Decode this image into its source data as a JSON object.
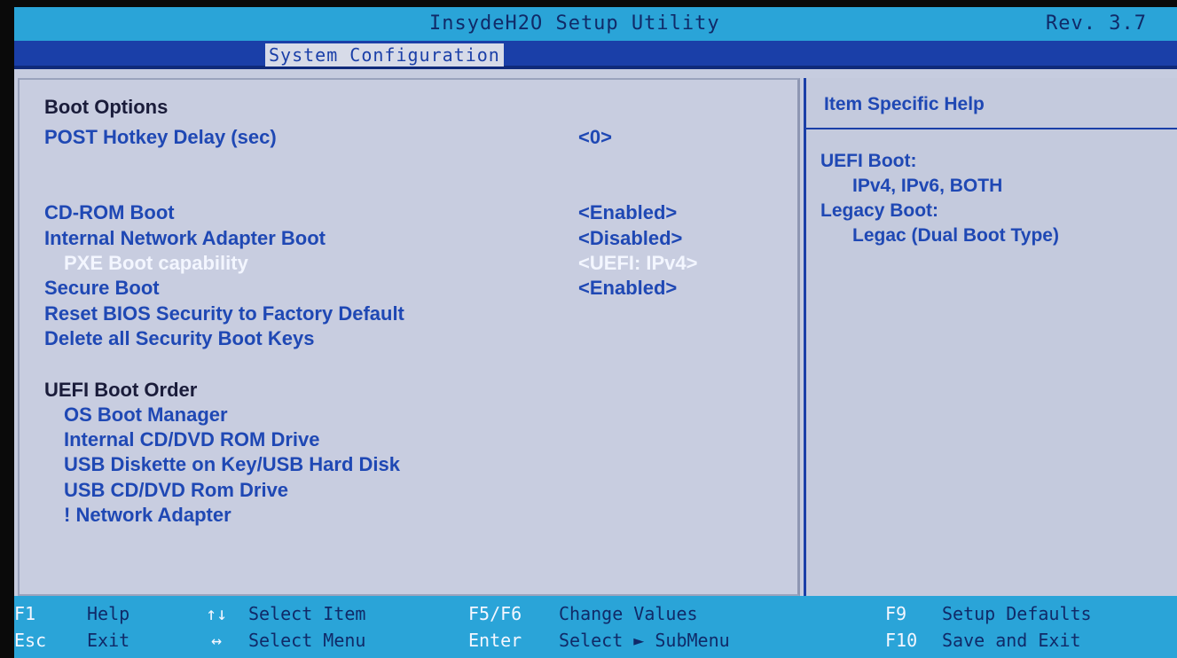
{
  "titlebar": {
    "title": "InsydeH2O Setup Utility",
    "rev": "Rev. 3.7"
  },
  "tab": {
    "active": "System Configuration"
  },
  "boot_options": {
    "section_label": "Boot Options",
    "items": [
      {
        "label": "POST Hotkey Delay (sec)",
        "value": "<0>"
      },
      {
        "label": "CD-ROM Boot",
        "value": "<Enabled>"
      },
      {
        "label": "Internal Network Adapter Boot",
        "value": "<Disabled>"
      },
      {
        "label": "PXE Boot capability",
        "value": "<UEFI: IPv4>"
      },
      {
        "label": "Secure Boot",
        "value": "<Enabled>"
      },
      {
        "label": "Reset BIOS Security to Factory Default",
        "value": ""
      },
      {
        "label": "Delete all Security Boot Keys",
        "value": ""
      }
    ]
  },
  "uefi_boot_order": {
    "section_label": "UEFI Boot Order",
    "items": [
      "OS Boot Manager",
      "Internal CD/DVD ROM Drive",
      "USB Diskette on Key/USB Hard Disk",
      "USB CD/DVD Rom Drive",
      "! Network Adapter"
    ]
  },
  "help": {
    "title": "Item Specific Help",
    "lines": [
      "UEFI Boot:",
      "IPv4, IPv6, BOTH",
      "Legacy Boot:",
      "Legac (Dual Boot Type)"
    ]
  },
  "footer": {
    "row1": [
      {
        "key": "F1",
        "desc": "Help"
      },
      {
        "key": "↑↓",
        "desc": "Select Item"
      },
      {
        "key": "F5/F6",
        "desc": "Change Values"
      },
      {
        "key": "F9",
        "desc": "Setup Defaults"
      }
    ],
    "row2": [
      {
        "key": "Esc",
        "desc": "Exit"
      },
      {
        "key": "↔",
        "desc": "Select Menu"
      },
      {
        "key": "Enter",
        "desc": "Select ► SubMenu"
      },
      {
        "key": "F10",
        "desc": "Save and Exit"
      }
    ]
  },
  "colors": {
    "title_bar": "#2aa4d8",
    "tab_bar": "#1a3fa8",
    "item_text": "#1f48b4",
    "selected_text": "#f3f6ff",
    "panel_bg": "#c6ccdf"
  }
}
